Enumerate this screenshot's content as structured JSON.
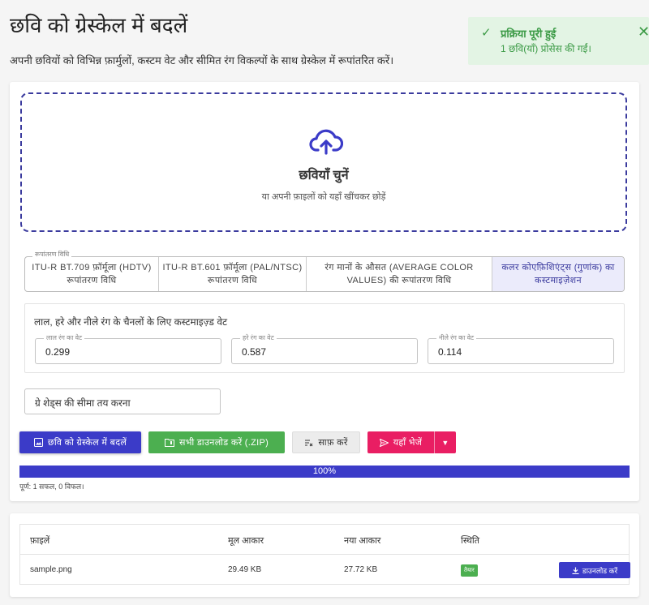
{
  "header": {
    "title": "छवि को ग्रेस्केल में बदलें",
    "subtitle": "अपनी छवियों को विभिन्न फ़ार्मुलों, कस्टम वेट और सीमित रंग विकल्पों के साथ ग्रेस्केल में रूपांतरित करें।"
  },
  "toast": {
    "title": "प्रक्रिया पूरी हुई",
    "message": "1 छवि(याँ) प्रोसेस की गईं।",
    "check_icon": "✓",
    "close_icon": "✕"
  },
  "dropzone": {
    "title": "छवियाँ चुनें",
    "hint": "या अपनी फ़ाइलों को यहाँ खींचकर छोड़ें",
    "icon": "cloud-upload-icon"
  },
  "method": {
    "legend": "रूपांतरण विधि",
    "options": [
      "ITU-R BT.709 फ़ॉर्मूला (HDTV) रूपांतरण विधि",
      "ITU-R BT.601 फ़ॉर्मूला (PAL/NTSC) रूपांतरण विधि",
      "रंग मानों के औसत (AVERAGE COLOR VALUES) की रूपांतरण विधि",
      "कलर कोएफ़िशिएंट्स (गुणांक) का कस्टमाइज़ेशन"
    ],
    "selected_index": 3
  },
  "weights": {
    "title": "लाल, हरे और नीले रंग के चैनलों के लिए कस्टमाइज़्ड वेट",
    "red_label": "लाल रंग का वेट",
    "red_value": "0.299",
    "green_label": "हरे रंग का वेट",
    "green_value": "0.587",
    "blue_label": "नीले रंग का वेट",
    "blue_value": "0.114"
  },
  "threshold": {
    "label": "ग्रे शेड्स की सीमा तय करना"
  },
  "actions": {
    "convert": "छवि को ग्रेस्केल में बदलें",
    "download_all": "सभी डाउनलोड करें (.ZIP)",
    "clear": "साफ़ करें",
    "send": "यहाँ भेजें",
    "convert_icon": "image-icon",
    "zip_icon": "folder-zip-icon",
    "clear_icon": "clear-icon",
    "send_icon": "send-icon",
    "dropdown_icon": "▼"
  },
  "progress": {
    "value": 1.0,
    "label": "100%",
    "status": "पूर्ण: 1 सफल, 0 विफल।"
  },
  "table": {
    "headers": [
      "फ़ाइलें",
      "मूल आकार",
      "नया आकार",
      "स्थिति"
    ],
    "rows": [
      {
        "file": "sample.png",
        "original_size": "29.49 KB",
        "new_size": "27.72 KB",
        "status": "तैयार",
        "download": "डाउनलोड करें"
      }
    ]
  },
  "colors": {
    "primary": "#3b3bc8",
    "success": "#4caf50",
    "send": "#e91e63",
    "toast_bg": "#e3f4e4",
    "toast_text": "#3d9b47"
  }
}
